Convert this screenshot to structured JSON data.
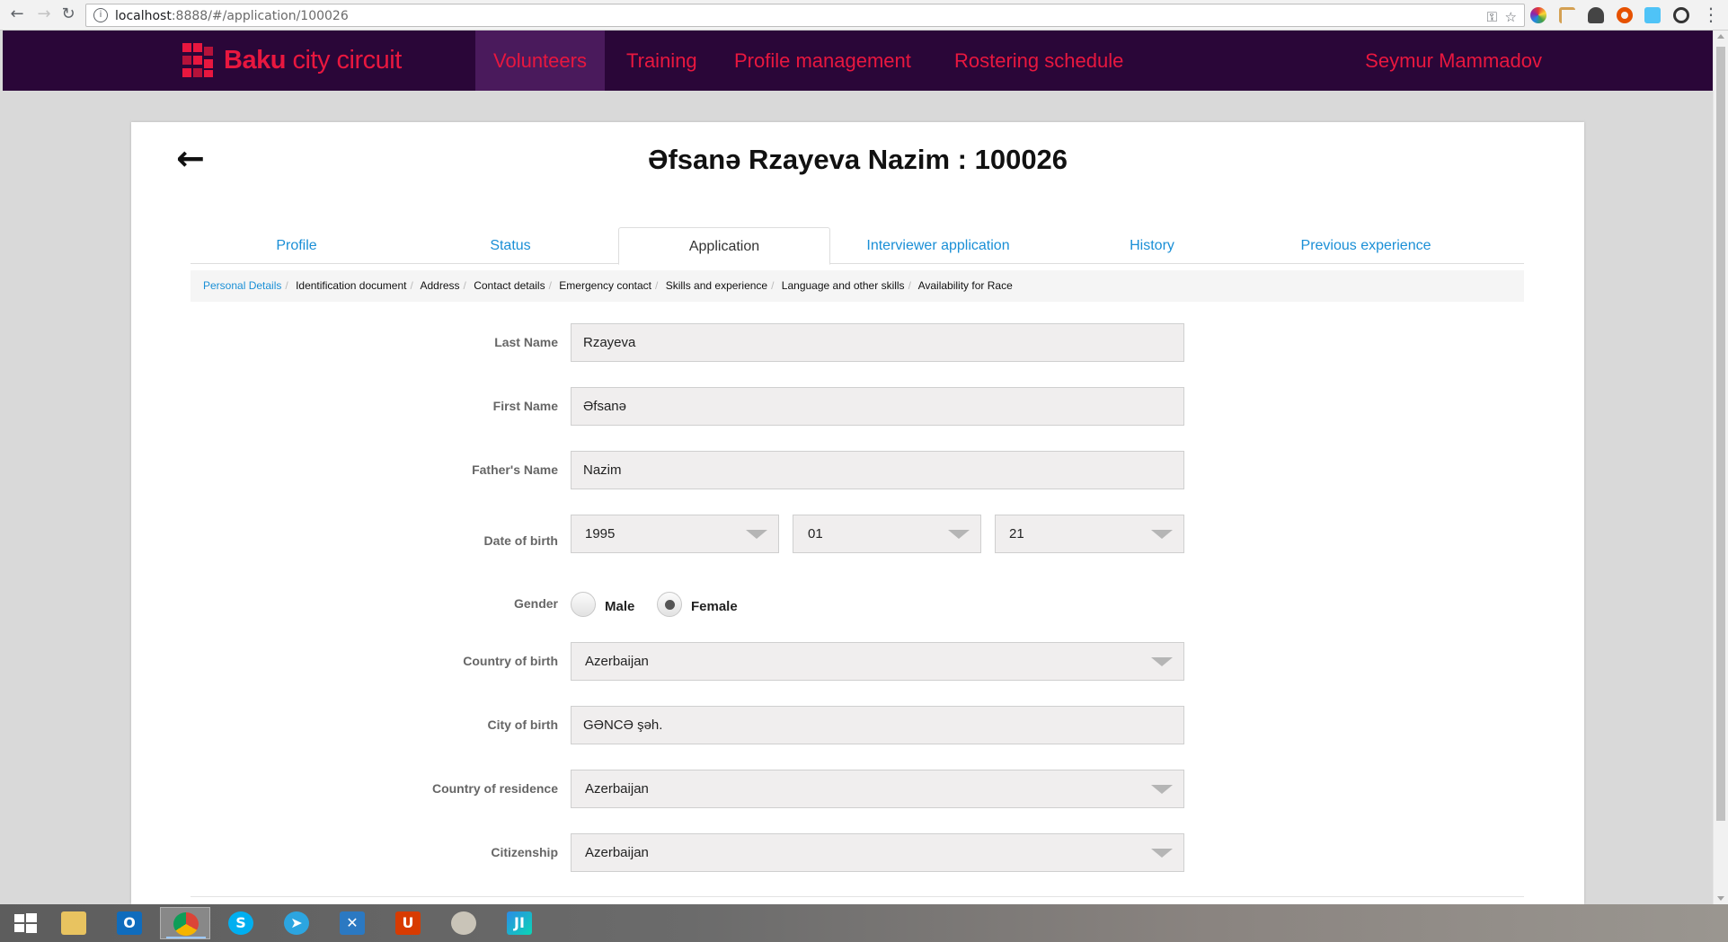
{
  "browser": {
    "url_host": "localhost",
    "url_path": ":8888/#/application/100026"
  },
  "header": {
    "logo_bold": "Baku",
    "logo_light": " city circuit",
    "nav": [
      {
        "label": "Volunteers",
        "active": true
      },
      {
        "label": "Training",
        "active": false
      },
      {
        "label": "Profile management",
        "active": false
      },
      {
        "label": "Rostering schedule",
        "active": false
      }
    ],
    "user_name": "Seymur Mammadov"
  },
  "page": {
    "title": "Əfsanə Rzayeva Nazim : 100026",
    "tabs": [
      {
        "label": "Profile",
        "active": false
      },
      {
        "label": "Status",
        "active": false
      },
      {
        "label": "Application",
        "active": true
      },
      {
        "label": "Interviewer application",
        "active": false
      },
      {
        "label": "History",
        "active": false
      },
      {
        "label": "Previous experience",
        "active": false
      }
    ],
    "breadcrumb": [
      "Personal Details",
      "Identification document",
      "Address",
      "Contact details",
      "Emergency contact",
      "Skills and experience",
      "Language and other skills",
      "Availability for Race"
    ]
  },
  "form": {
    "last_name": {
      "label": "Last Name",
      "value": "Rzayeva"
    },
    "first_name": {
      "label": "First Name",
      "value": "Əfsanə"
    },
    "fathers_name": {
      "label": "Father's Name",
      "value": "Nazim"
    },
    "date_of_birth": {
      "label": "Date of birth",
      "year": "1995",
      "month": "01",
      "day": "21"
    },
    "gender": {
      "label": "Gender",
      "options": [
        "Male",
        "Female"
      ],
      "selected": "Female"
    },
    "country_of_birth": {
      "label": "Country of birth",
      "value": "Azerbaijan"
    },
    "city_of_birth": {
      "label": "City of birth",
      "value": "GƏNCƏ şəh."
    },
    "country_of_residence": {
      "label": "Country of residence",
      "value": "Azerbaijan"
    },
    "citizenship": {
      "label": "Citizenship",
      "value": "Azerbaijan"
    }
  },
  "colors": {
    "brand_red": "#e8173f",
    "header_bg": "#2a0638",
    "active_nav_bg": "#4a1a5c",
    "link_blue": "#1a8fd6"
  }
}
